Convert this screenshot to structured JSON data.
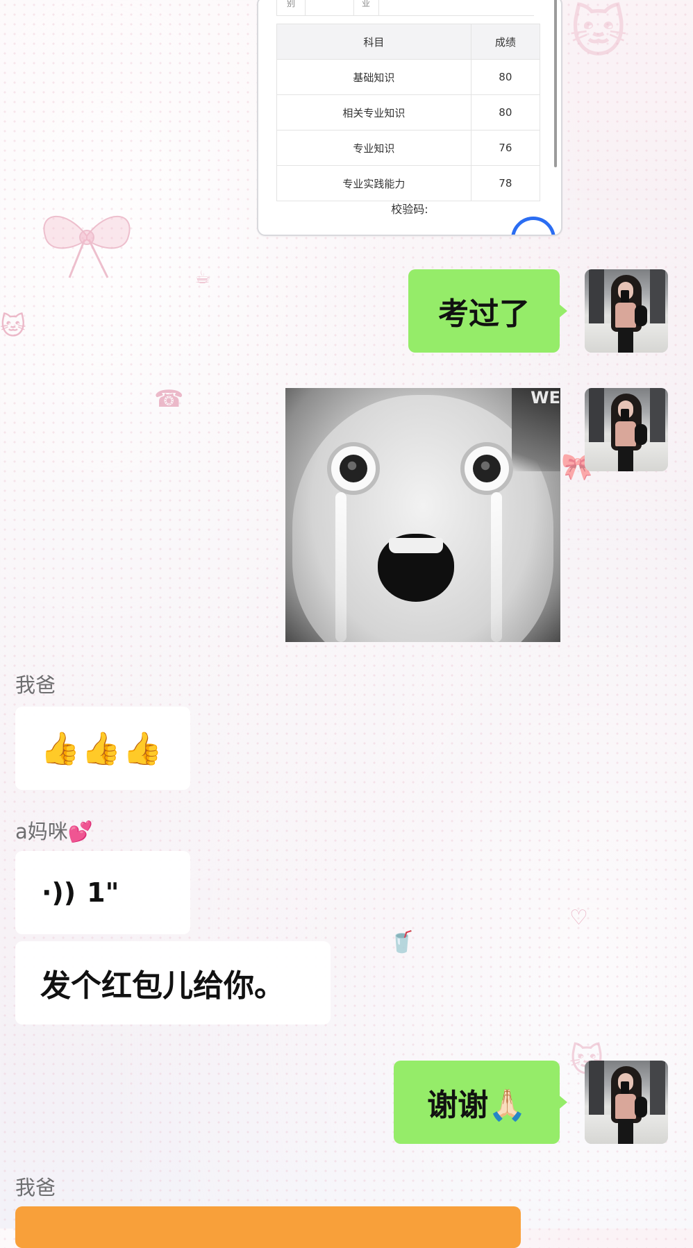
{
  "score_card": {
    "top_row_cells": [
      "别",
      "业"
    ],
    "headers": [
      "科目",
      "成绩"
    ],
    "rows": [
      {
        "subject": "基础知识",
        "score": "80"
      },
      {
        "subject": "相关专业知识",
        "score": "80"
      },
      {
        "subject": "专业知识",
        "score": "76"
      },
      {
        "subject": "专业实践能力",
        "score": "78"
      }
    ],
    "verify_label": "校验码:"
  },
  "messages": [
    {
      "id": "m1",
      "side": "right",
      "type": "text",
      "text": "考过了"
    },
    {
      "id": "m2",
      "side": "right",
      "type": "sticker",
      "sticker_text": "WE"
    },
    {
      "id": "m3",
      "side": "left",
      "sender": "我爸",
      "type": "emoji",
      "text": "👍👍👍"
    },
    {
      "id": "m4",
      "side": "left",
      "sender": "a妈咪💕",
      "type": "voice",
      "icon": "voice-wave-icon",
      "duration": "1\""
    },
    {
      "id": "m5",
      "side": "left",
      "type": "text",
      "text": "发个红包儿给你。"
    },
    {
      "id": "m6",
      "side": "right",
      "type": "text",
      "text": "谢谢🙏🏻"
    },
    {
      "id": "m7",
      "side": "left",
      "sender": "我爸",
      "type": "red-packet"
    }
  ],
  "colors": {
    "bubble_green": "#95ec69",
    "bubble_white": "#ffffff",
    "red_packet": "#f8a03a",
    "link_blue": "#2b6df2"
  }
}
